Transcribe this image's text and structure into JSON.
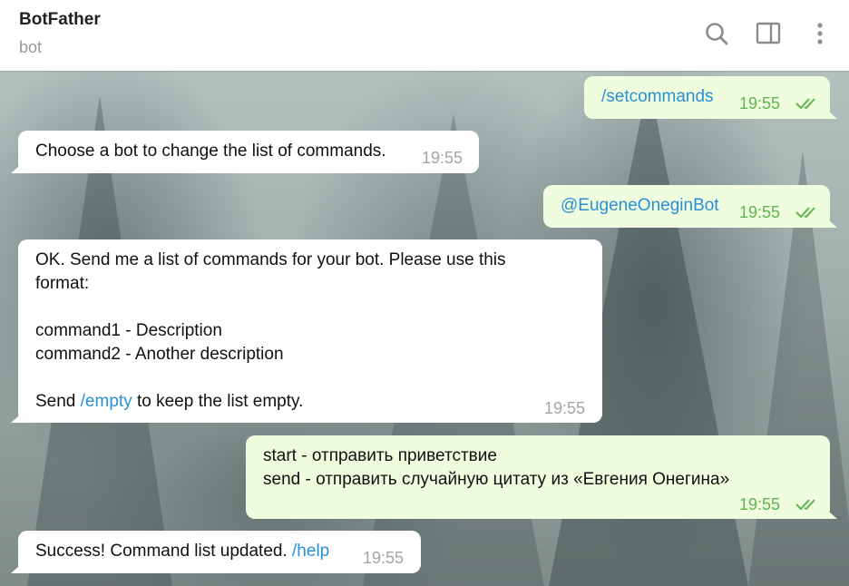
{
  "header": {
    "title": "BotFather",
    "subtitle": "bot",
    "icons": [
      "search-icon",
      "sidebar-panel-icon",
      "more-vertical-icon"
    ]
  },
  "colors": {
    "incoming_bubble": "#ffffff",
    "outgoing_bubble": "#effdde",
    "outgoing_time": "#5fb452",
    "link": "#2a8fd6"
  },
  "messages": [
    {
      "dir": "out",
      "link": "/setcommands",
      "time": "19:55",
      "status": "read"
    },
    {
      "dir": "in",
      "text": "Choose a bot to change the list of commands.",
      "time": "19:55"
    },
    {
      "dir": "out",
      "link": "@EugeneOneginBot",
      "time": "19:55",
      "status": "read"
    },
    {
      "dir": "in",
      "line1": "OK. Send me a list of commands for your bot. Please use this",
      "line2": "format:",
      "line3": "command1 - Description",
      "line4": "command2 - Another description",
      "send_prefix": "Send ",
      "send_link": "/empty",
      "send_suffix": " to keep the list empty.",
      "time": "19:55"
    },
    {
      "dir": "out",
      "line1": "start - отправить приветствие",
      "line2": "send - отправить случайную цитату из «Евгения Онегина»",
      "time": "19:55",
      "status": "read"
    },
    {
      "dir": "in",
      "text": "Success! Command list updated. ",
      "link": "/help",
      "time": "19:55"
    }
  ]
}
